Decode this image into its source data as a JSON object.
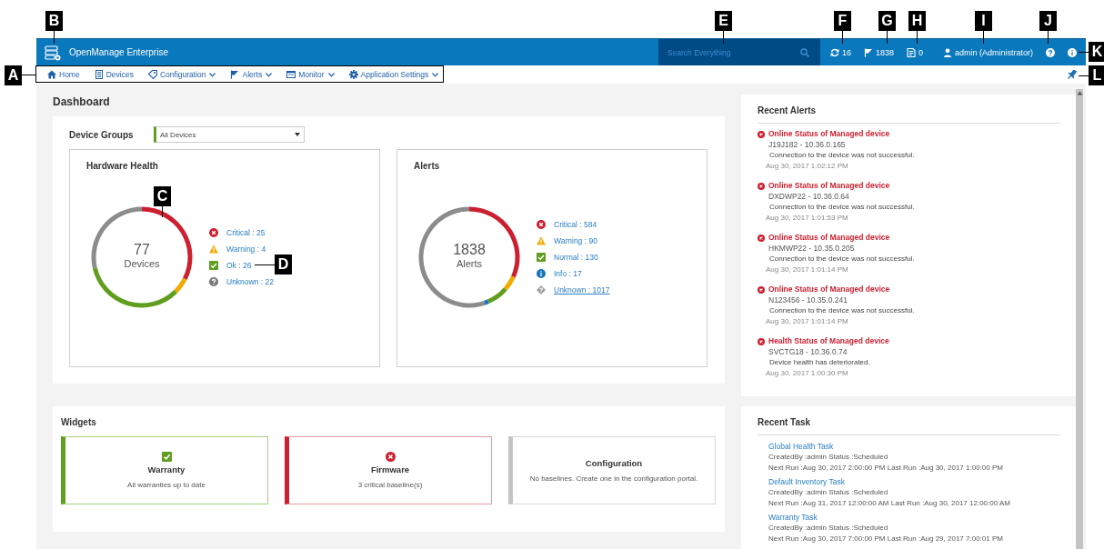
{
  "callouts": [
    {
      "letter": "A"
    },
    {
      "letter": "B"
    },
    {
      "letter": "C"
    },
    {
      "letter": "D"
    },
    {
      "letter": "E"
    },
    {
      "letter": "F"
    },
    {
      "letter": "G"
    },
    {
      "letter": "H"
    },
    {
      "letter": "I"
    },
    {
      "letter": "J"
    },
    {
      "letter": "K"
    },
    {
      "letter": "L"
    }
  ],
  "header": {
    "product": "OpenManage Enterprise",
    "search": {
      "placeholder": "Search Everything"
    },
    "indicators": [
      {
        "kind": "jobs",
        "text": "16"
      },
      {
        "kind": "alerts",
        "text": "1838"
      },
      {
        "kind": "warranty",
        "text": "0"
      },
      {
        "kind": "user",
        "text": "admin (Administrator)"
      }
    ],
    "tools": [
      {
        "kind": "help"
      },
      {
        "kind": "info"
      }
    ]
  },
  "nav": [
    {
      "label": "Home",
      "kind": "home",
      "dropdown": false
    },
    {
      "label": "Devices",
      "kind": "devices",
      "dropdown": false
    },
    {
      "label": "Configuration",
      "kind": "configuration",
      "dropdown": true
    },
    {
      "label": "Alerts",
      "kind": "alerts",
      "dropdown": true
    },
    {
      "label": "Monitor",
      "kind": "monitor",
      "dropdown": true
    },
    {
      "label": "Application Settings",
      "kind": "settings",
      "dropdown": true
    }
  ],
  "page_title": "Dashboard",
  "device_groups": {
    "label": "Device Groups",
    "value": "All Devices"
  },
  "panels": [
    {
      "title": "Hardware Health",
      "center_value": "77",
      "center_label": "Devices",
      "chart_data": {
        "type": "donut",
        "categories": [
          "Critical : 25",
          "Warning : 4",
          "Ok : 26",
          "Unknown : 22"
        ],
        "series": [
          {
            "values": [
              25,
              4,
              26,
              22
            ]
          }
        ],
        "colors": [
          "#cc1f30",
          "#f0ab00",
          "#5f9e1f",
          "#8c8c8c"
        ]
      },
      "legend": [
        {
          "kind": "critical",
          "hovered": false
        },
        {
          "kind": "warning",
          "hovered": false
        },
        {
          "kind": "ok",
          "hovered": false
        },
        {
          "kind": "unknown",
          "hovered": false
        }
      ]
    },
    {
      "title": "Alerts",
      "center_value": "1838",
      "center_label": "Alerts",
      "chart_data": {
        "type": "donut",
        "categories": [
          "Critical : 584",
          "Warning : 90",
          "Normal : 130",
          "Info : 17",
          "Unknown : 1017"
        ],
        "series": [
          {
            "values": [
              584,
              90,
              130,
              17,
              1017
            ]
          }
        ],
        "colors": [
          "#cc1f30",
          "#f0ab00",
          "#5f9e1f",
          "#1a75bb",
          "#8c8c8c"
        ]
      },
      "legend": [
        {
          "kind": "critical",
          "hovered": false
        },
        {
          "kind": "warning",
          "hovered": false
        },
        {
          "kind": "ok",
          "hovered": false
        },
        {
          "kind": "info",
          "hovered": false
        },
        {
          "kind": "unclassified",
          "hovered": true
        }
      ]
    }
  ],
  "widgets": {
    "title": "Widgets",
    "items": [
      {
        "title": "Warranty",
        "text": "All warranties up to date",
        "kind": "ok"
      },
      {
        "title": "Firmware",
        "text": "3 critical baseline(s)",
        "kind": "critical"
      },
      {
        "title": "Configuration",
        "text": "No baselines. Create one in the configuration portal.",
        "kind": "none"
      }
    ]
  },
  "recent_alerts": {
    "title": "Recent Alerts",
    "items": [
      {
        "title": "Online Status of Managed device",
        "device": "J19J182 - 10.36.0.165",
        "message": "Connection to the device was not successful.",
        "time": "Aug 30, 2017 1:02:12 PM"
      },
      {
        "title": "Online Status of Managed device",
        "device": "DXDWP22 - 10.36.0.64",
        "message": "Connection to the device was not successful.",
        "time": "Aug 30, 2017 1:01:53 PM"
      },
      {
        "title": "Online Status of Managed device",
        "device": "HKMWP22 - 10.35.0.205",
        "message": "Connection to the device was not successful.",
        "time": "Aug 30, 2017 1:01:14 PM"
      },
      {
        "title": "Online Status of Managed device",
        "device": "N123456 - 10.35.0.241",
        "message": "Connection to the device was not successful.",
        "time": "Aug 30, 2017 1:01:14 PM"
      },
      {
        "title": "Health Status of Managed device",
        "device": "SVCTG18 - 10.36.0.74",
        "message": "Device health has deteriorated.",
        "time": "Aug 30, 2017 1:00:30 PM"
      }
    ]
  },
  "recent_task": {
    "title": "Recent Task",
    "items": [
      {
        "name": "Global Health Task",
        "status": "CreatedBy :admin Status :Scheduled",
        "runs": "Next Run :Aug 30, 2017 2:00:00 PM Last Run :Aug 30, 2017 1:00:00 PM"
      },
      {
        "name": "Default Inventory Task",
        "status": "CreatedBy :admin Status :Scheduled",
        "runs": "Next Run :Aug 31, 2017 12:00:00 AM Last Run :Aug 30, 2017 12:00:00 AM"
      },
      {
        "name": "Warranty Task",
        "status": "CreatedBy :admin Status :Scheduled",
        "runs": "Next Run :Aug 30, 2017 7:00:00 PM Last Run :Aug 29, 2017 7:00:01 PM"
      }
    ]
  }
}
